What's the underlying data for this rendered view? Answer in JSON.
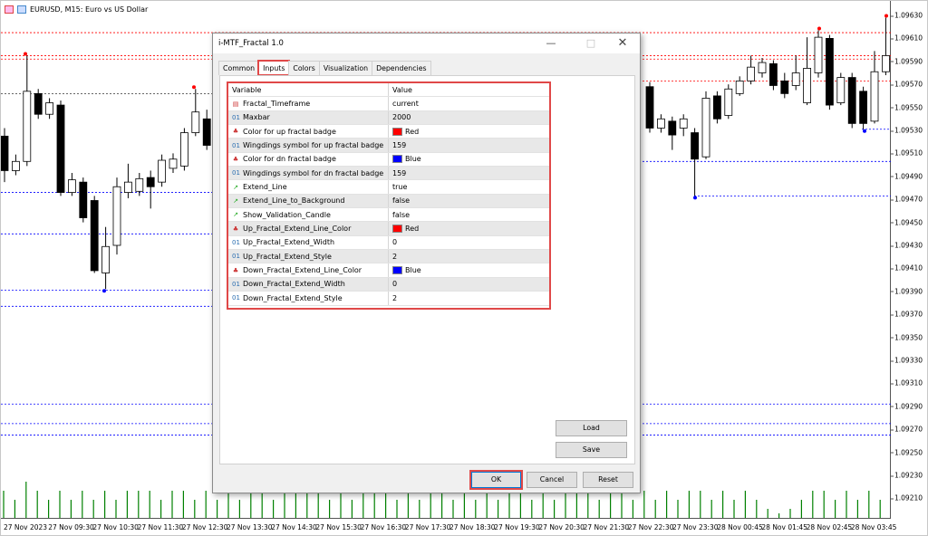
{
  "chart": {
    "title": "EURUSD, M15:  Euro vs US Dollar",
    "price_range": [
      1.092,
      1.0964
    ],
    "y_ticks": [
      "1.09630",
      "1.09610",
      "1.09590",
      "1.09570",
      "1.09550",
      "1.09530",
      "1.09510",
      "1.09490",
      "1.09470",
      "1.09450",
      "1.09430",
      "1.09410",
      "1.09390",
      "1.09370",
      "1.09350",
      "1.09330",
      "1.09310",
      "1.09290",
      "1.09270",
      "1.09250",
      "1.09230",
      "1.09210"
    ],
    "x_ticks": [
      "27 Nov 2023",
      "27 Nov 09:30",
      "27 Nov 10:30",
      "27 Nov 11:30",
      "27 Nov 12:30",
      "27 Nov 13:30",
      "27 Nov 14:30",
      "27 Nov 15:30",
      "27 Nov 16:30",
      "27 Nov 17:30",
      "27 Nov 18:30",
      "27 Nov 19:30",
      "27 Nov 20:30",
      "27 Nov 21:30",
      "27 Nov 22:30",
      "27 Nov 23:30",
      "28 Nov 00:45",
      "28 Nov 01:45",
      "28 Nov 02:45",
      "28 Nov 03:45"
    ],
    "candles_left": [
      [
        1.09525,
        1.09532,
        1.09485,
        1.09495
      ],
      [
        1.09495,
        1.09509,
        1.09491,
        1.09503
      ],
      [
        1.09503,
        1.09595,
        1.09499,
        1.09564
      ],
      [
        1.09562,
        1.09566,
        1.0954,
        1.09544
      ],
      [
        1.09544,
        1.09558,
        1.0954,
        1.09554
      ],
      [
        1.09552,
        1.09556,
        1.09473,
        1.09476
      ],
      [
        1.09476,
        1.09493,
        1.09473,
        1.09487
      ],
      [
        1.09485,
        1.09489,
        1.0945,
        1.09454
      ],
      [
        1.09469,
        1.09473,
        1.09406,
        1.09408
      ],
      [
        1.09406,
        1.09446,
        1.09392,
        1.09429
      ],
      [
        1.0943,
        1.09489,
        1.09422,
        1.09481
      ],
      [
        1.09476,
        1.09501,
        1.09471,
        1.09485
      ],
      [
        1.09477,
        1.09493,
        1.09473,
        1.09488
      ],
      [
        1.09489,
        1.09495,
        1.09462,
        1.09481
      ],
      [
        1.09485,
        1.09509,
        1.09481,
        1.09504
      ],
      [
        1.09497,
        1.0951,
        1.09493,
        1.09505
      ],
      [
        1.09499,
        1.09532,
        1.09495,
        1.09528
      ],
      [
        1.09528,
        1.09566,
        1.09525,
        1.09546
      ],
      [
        1.0954,
        1.09548,
        1.09513,
        1.09517
      ]
    ],
    "candles_right": [
      [
        1.09568,
        1.09572,
        1.09528,
        1.09532
      ],
      [
        1.09532,
        1.09544,
        1.09528,
        1.0954
      ],
      [
        1.09538,
        1.09542,
        1.09513,
        1.09526
      ],
      [
        1.09532,
        1.09544,
        1.09525,
        1.0954
      ],
      [
        1.09528,
        1.09532,
        1.09473,
        1.09505
      ],
      [
        1.09507,
        1.09564,
        1.09505,
        1.09558
      ],
      [
        1.0956,
        1.09564,
        1.09536,
        1.0954
      ],
      [
        1.09543,
        1.0957,
        1.0954,
        1.09566
      ],
      [
        1.09562,
        1.09577,
        1.0956,
        1.09573
      ],
      [
        1.09573,
        1.09595,
        1.0957,
        1.09585
      ],
      [
        1.0958,
        1.09593,
        1.09576,
        1.09589
      ],
      [
        1.09588,
        1.09591,
        1.09565,
        1.09569
      ],
      [
        1.09573,
        1.0958,
        1.09558,
        1.09562
      ],
      [
        1.09569,
        1.09595,
        1.09565,
        1.0958
      ],
      [
        1.09554,
        1.09611,
        1.09552,
        1.09584
      ],
      [
        1.0958,
        1.09617,
        1.09576,
        1.09611
      ],
      [
        1.0961,
        1.09613,
        1.09548,
        1.09552
      ],
      [
        1.09554,
        1.0958,
        1.09552,
        1.09576
      ],
      [
        1.09576,
        1.0958,
        1.09532,
        1.09536
      ],
      [
        1.09564,
        1.09568,
        1.09531,
        1.09536
      ],
      [
        1.09538,
        1.09599,
        1.09536,
        1.09581
      ],
      [
        1.09581,
        1.09628,
        1.09578,
        1.09595
      ]
    ],
    "up_levels": [
      1.09615,
      1.09595,
      1.09592,
      1.09573
    ],
    "down_levels": [
      1.09476,
      1.0944,
      1.09391,
      1.09377,
      1.09531,
      1.09503,
      1.09473,
      1.09292,
      1.09275,
      1.09265
    ],
    "neutral_levels": [
      1.09562
    ],
    "volumes": [
      3,
      2,
      4,
      3,
      2,
      3,
      2,
      3,
      2,
      3,
      2,
      3,
      3,
      3,
      2,
      3,
      3,
      2,
      3,
      2,
      3,
      2,
      3,
      3,
      2,
      3,
      3,
      3,
      3,
      2,
      3,
      2,
      3,
      3,
      3,
      2,
      3,
      2,
      3,
      3,
      2,
      3,
      2,
      3,
      2,
      3,
      3,
      2,
      3,
      2,
      3,
      3,
      3,
      2,
      3,
      3,
      2,
      3,
      2,
      3,
      2,
      3,
      3,
      2,
      3,
      2,
      3,
      2,
      1,
      0.5,
      1,
      2,
      3,
      3,
      2,
      3,
      2,
      3,
      2
    ],
    "colors": {
      "up": "#ff0000",
      "down": "#0000ff",
      "volume": "#008000"
    }
  },
  "dialog": {
    "title": "i-MTF_Fractal 1.0",
    "tabs": [
      "Common",
      "Inputs",
      "Colors",
      "Visualization",
      "Dependencies"
    ],
    "columns": [
      "Variable",
      "Value"
    ],
    "rows": [
      {
        "type": "enum",
        "variable": "Fractal_Timeframe",
        "value": "current"
      },
      {
        "type": "int",
        "variable": "Maxbar",
        "value": "2000"
      },
      {
        "type": "color",
        "variable": "Color for up fractal badge",
        "value": "Red",
        "swatch": "#ff0000"
      },
      {
        "type": "int",
        "variable": "Wingdings symbol for up fractal badge",
        "value": "159"
      },
      {
        "type": "color",
        "variable": "Color for dn fractal badge",
        "value": "Blue",
        "swatch": "#0000ff"
      },
      {
        "type": "int",
        "variable": "Wingdings symbol for dn fractal badge",
        "value": "159"
      },
      {
        "type": "bool",
        "variable": "Extend_Line",
        "value": "true"
      },
      {
        "type": "bool",
        "variable": "Extend_Line_to_Background",
        "value": "false"
      },
      {
        "type": "bool",
        "variable": "Show_Validation_Candle",
        "value": "false"
      },
      {
        "type": "color",
        "variable": "Up_Fractal_Extend_Line_Color",
        "value": "Red",
        "swatch": "#ff0000"
      },
      {
        "type": "int",
        "variable": "Up_Fractal_Extend_Width",
        "value": "0"
      },
      {
        "type": "int",
        "variable": "Up_Fractal_Extend_Style",
        "value": "2"
      },
      {
        "type": "color",
        "variable": "Down_Fractal_Extend_Line_Color",
        "value": "Blue",
        "swatch": "#0000ff"
      },
      {
        "type": "int",
        "variable": "Down_Fractal_Extend_Width",
        "value": "0"
      },
      {
        "type": "int",
        "variable": "Down_Fractal_Extend_Style",
        "value": "2"
      }
    ],
    "load": "Load",
    "save": "Save",
    "ok": "OK",
    "cancel": "Cancel",
    "reset": "Reset"
  }
}
